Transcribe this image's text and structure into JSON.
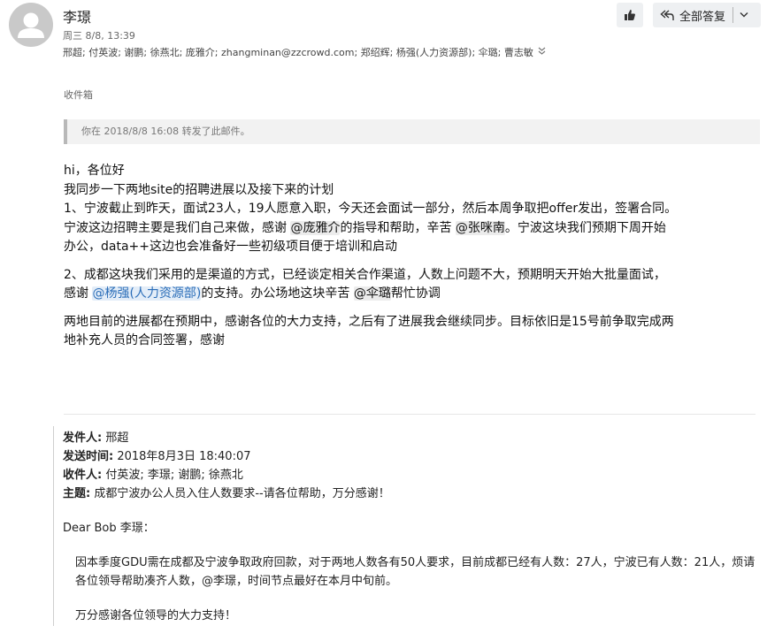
{
  "header": {
    "sender_name": "李璟",
    "date": "周三 8/8, 13:39",
    "recipients": "邢超; 付英波; 谢鹏; 徐燕北; 庞雅介; zhangminan@zzcrowd.com; 郑绍辉; 杨强(人力资源部); 伞璐; 曹志敏",
    "reply_all_label": "全部答复",
    "folder": "收件箱"
  },
  "forward_note": "你在 2018/8/8 16:08 转发了此邮件。",
  "body": {
    "line1": "hi，各位好",
    "line2": "我同步一下两地site的招聘进展以及接下来的计划",
    "p1_line1": "1、宁波截止到昨天，面试23人，19人愿意入职，今天还会面试一部分，然后本周争取把offer发出，签署合同。",
    "p1_line2_a": "宁波这边招聘主要是我们自己来做，感谢 ",
    "mention1": "@庞雅介",
    "p1_line2_b": "的指导和帮助，辛苦 ",
    "mention2": "@张咪南",
    "p1_line2_c": "。宁波这块我们预期下周开始",
    "p1_line3": "办公，data++这边也会准备好一些初级项目便于培训和启动",
    "p2_line1": "2、成都这块我们采用的是渠道的方式，已经谈定相关合作渠道，人数上问题不大，预期明天开始大批量面试，",
    "p2_line2_a": "感谢 ",
    "mention3": "@杨强(人力资源部)",
    "p2_line2_b": "的支持。办公场地这块辛苦 ",
    "mention4": "@伞璐",
    "p2_line2_c": "帮忙协调",
    "p3_line1": "两地目前的进展都在预期中，感谢各位的大力支持，之后有了进展我会继续同步。目标依旧是15号前争取完成两",
    "p3_line2": "地补充人员的合同签署，感谢"
  },
  "quoted": {
    "from_label": "发件人:",
    "from_value": "邢超",
    "sent_label": "发送时间:",
    "sent_value": "2018年8月3日 18:40:07",
    "to_label": "收件人:",
    "to_value": "付英波; 李璟; 谢鹏; 徐燕北",
    "subject_label": "主题:",
    "subject_value": "成都宁波办公人员入住人数要求--请各位帮助，万分感谢！",
    "greeting": "Dear Bob 李璟：",
    "para1": "因本季度GDU需在成都及宁波争取政府回款，对于两地人数各有50人要求，目前成都已经有人数：27人，宁波已有人数：21人，烦请各位领导帮助凑齐人数，@李璟，时间节点最好在本月中旬前。",
    "para2": "万分感谢各位领导的大力支持！"
  },
  "icons": {
    "avatar": "person-icon",
    "like": "thumbs-up-icon",
    "reply_all": "reply-all-icon",
    "dropdown": "chevron-down-icon",
    "expand": "double-chevron-down-icon"
  }
}
